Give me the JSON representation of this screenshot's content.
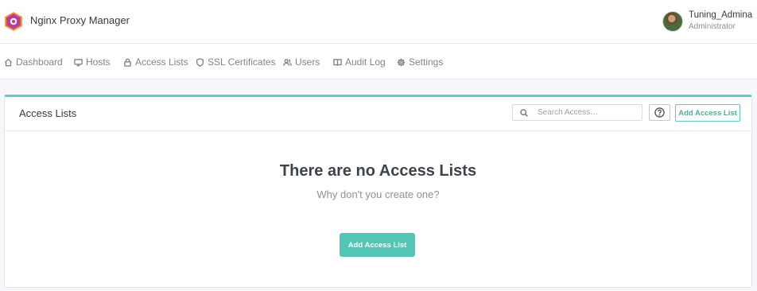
{
  "header": {
    "app_title": "Nginx Proxy Manager",
    "user_name": "Tuning_Admina",
    "user_role": "Administrator"
  },
  "nav": {
    "items": [
      {
        "label": "Dashboard",
        "icon": "home-icon"
      },
      {
        "label": "Hosts",
        "icon": "monitor-icon"
      },
      {
        "label": "Access Lists",
        "icon": "lock-icon"
      },
      {
        "label": "SSL Certificates",
        "icon": "shield-icon"
      },
      {
        "label": "Users",
        "icon": "users-icon"
      },
      {
        "label": "Audit Log",
        "icon": "book-icon"
      },
      {
        "label": "Settings",
        "icon": "gear-icon"
      }
    ]
  },
  "card": {
    "title": "Access Lists",
    "search_placeholder": "Search Access…",
    "help_icon": "help-circle-icon",
    "add_button_label": "Add Access List"
  },
  "empty_state": {
    "title": "There are no Access Lists",
    "subtitle": "Why don't you create one?",
    "button_label": "Add Access List"
  },
  "colors": {
    "accent": "#52c6b6",
    "card_top_border": "#5ecdc0",
    "background": "#f5f7fb"
  }
}
